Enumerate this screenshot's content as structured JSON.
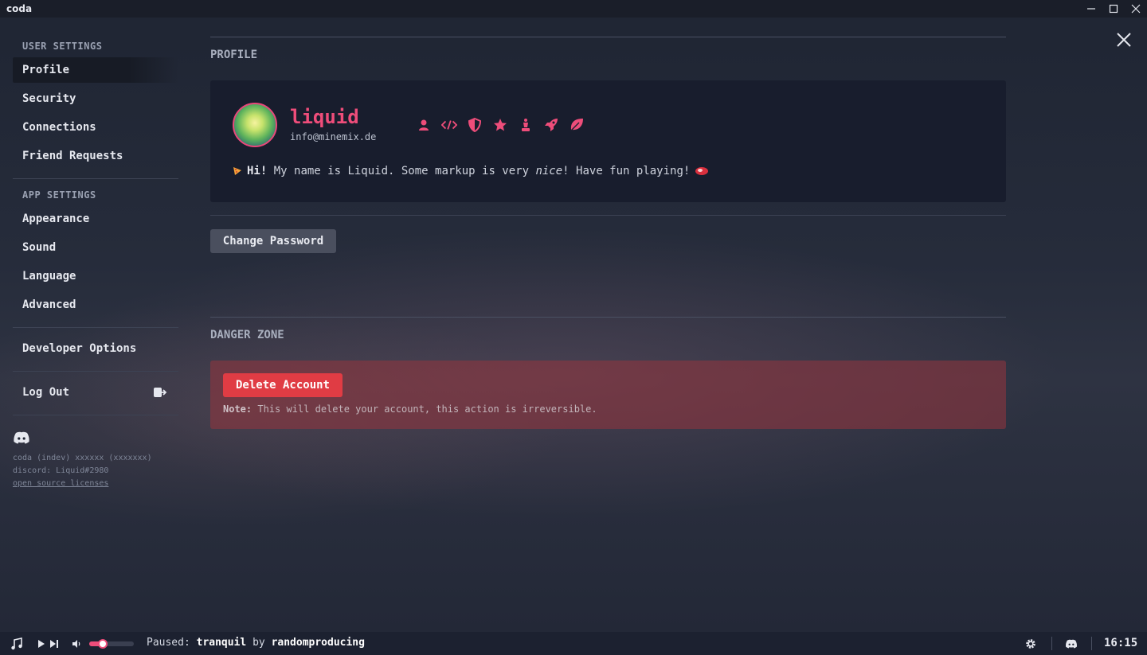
{
  "window": {
    "title": "coda"
  },
  "sidebar": {
    "user_settings_label": "USER SETTINGS",
    "user_items": [
      {
        "label": "Profile",
        "active": true
      },
      {
        "label": "Security"
      },
      {
        "label": "Connections"
      },
      {
        "label": "Friend Requests"
      }
    ],
    "app_settings_label": "APP SETTINGS",
    "app_items": [
      {
        "label": "Appearance"
      },
      {
        "label": "Sound"
      },
      {
        "label": "Language"
      },
      {
        "label": "Advanced"
      }
    ],
    "developer_options": "Developer Options",
    "log_out": "Log Out",
    "meta": {
      "version": "coda (indev) xxxxxx (xxxxxxx)",
      "discord": "discord: Liquid#2980",
      "licenses": "open source licenses"
    }
  },
  "profile": {
    "heading": "PROFILE",
    "username": "liquid",
    "email": "info@minemix.de",
    "badges": [
      "user-icon",
      "code-icon",
      "shield-icon",
      "star-icon",
      "chess-icon",
      "rocket-icon",
      "leaf-icon"
    ],
    "bio": {
      "bold": "Hi!",
      "pre": " My name is Liquid. Some markup is very ",
      "italic": "nice",
      "post": "! Have fun playing!"
    },
    "change_password": "Change Password"
  },
  "danger": {
    "heading": "DANGER ZONE",
    "delete_label": "Delete Account",
    "note_label": "Note:",
    "note_text": " This will delete your account, this action is irreversible."
  },
  "player": {
    "status": "Paused:",
    "track": "tranquil",
    "by": " by ",
    "artist": "randomproducing",
    "volume": 0.3,
    "clock": "16:15"
  },
  "colors": {
    "accent": "#ee4d7a",
    "danger": "#e03c44",
    "button": "#4a4f5e"
  }
}
